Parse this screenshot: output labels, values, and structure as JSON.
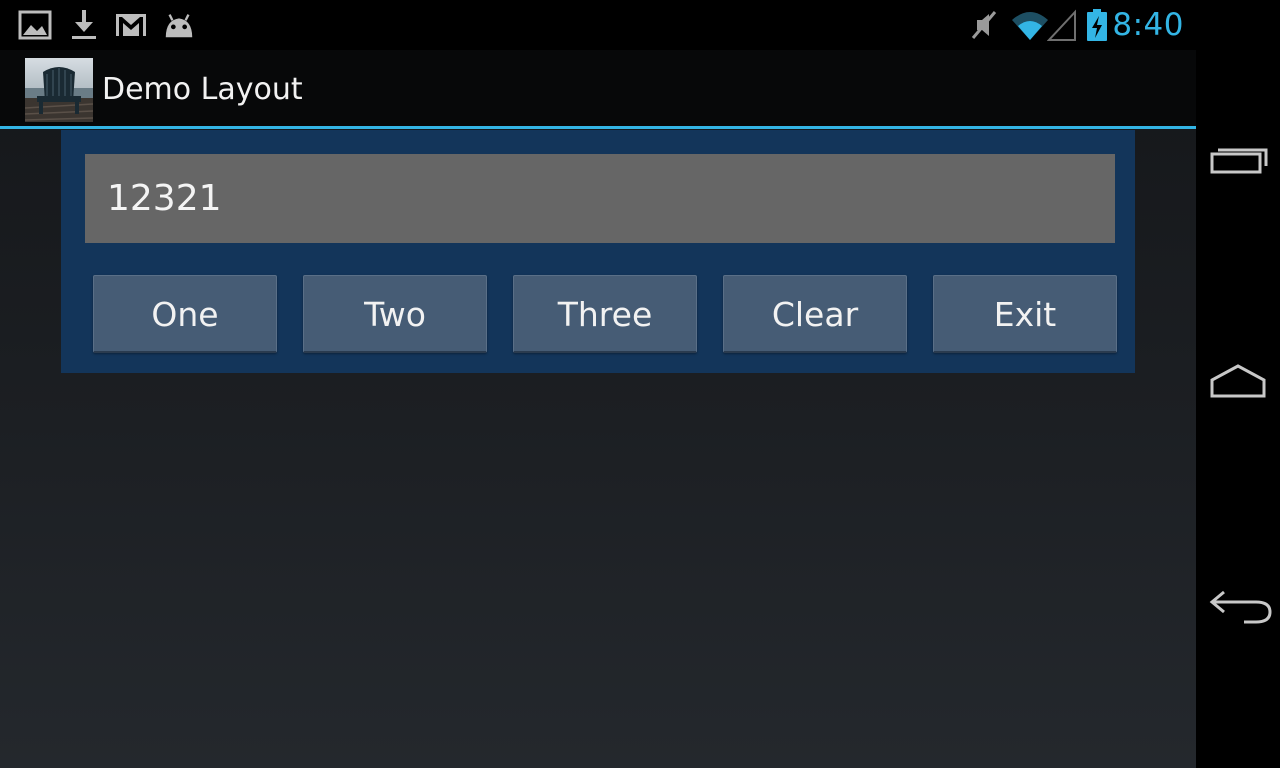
{
  "status_bar": {
    "notification_icons": [
      "gallery-icon",
      "download-icon",
      "gmail-icon",
      "android-icon"
    ],
    "system_icons": [
      "mute-icon",
      "wifi-icon",
      "signal-icon",
      "battery-charging-icon"
    ],
    "time": "8:40",
    "accent_color": "#33b5e5"
  },
  "action_bar": {
    "title": "Demo Layout",
    "app_icon": "chair-photo-icon"
  },
  "main": {
    "display_value": "12321",
    "buttons": [
      {
        "label": "One"
      },
      {
        "label": "Two"
      },
      {
        "label": "Three"
      },
      {
        "label": "Clear"
      },
      {
        "label": "Exit"
      }
    ],
    "panel_color": "#13355a",
    "display_color": "#666666",
    "button_color": "#465c75"
  },
  "nav_bar": {
    "buttons": [
      "recent-apps-icon",
      "home-icon",
      "back-icon"
    ]
  }
}
